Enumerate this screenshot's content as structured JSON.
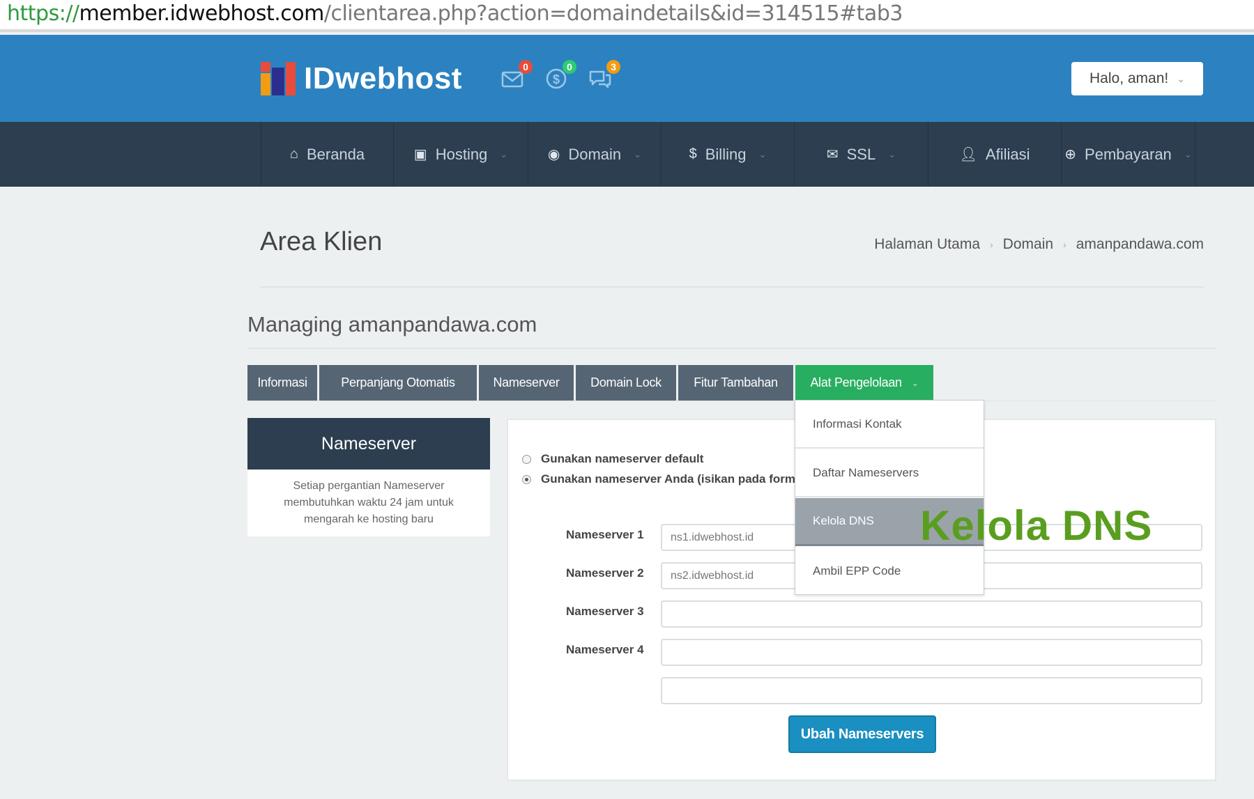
{
  "browser": {
    "url_protocol": "https://",
    "url_host": "member.idwebhost.com",
    "url_path": "/clientarea.php?action=domaindetails&id=314515#tab3"
  },
  "header": {
    "brand": "IDwebhost",
    "icons": [
      {
        "name": "envelope-icon",
        "count": "0",
        "badge_color": "#e74c3c"
      },
      {
        "name": "dollar-icon",
        "count": "0",
        "badge_color": "#2ecc71"
      },
      {
        "name": "chat-icon",
        "count": "3",
        "badge_color": "#f39c12"
      }
    ],
    "user_greeting": "Halo, aman!",
    "colors": {
      "header_bg": "#2c82c0",
      "nav_bg": "#2c3e50"
    }
  },
  "nav": {
    "items": [
      {
        "label": "Beranda",
        "icon": "home-icon"
      },
      {
        "label": "Hosting",
        "icon": "server-icon"
      },
      {
        "label": "Domain",
        "icon": "binoculars-icon"
      },
      {
        "label": "Billing",
        "icon": "dollar-icon"
      },
      {
        "label": "SSL",
        "icon": "envelope-icon"
      },
      {
        "label": "Afiliasi",
        "icon": "user-icon"
      },
      {
        "label": "Pembayaran",
        "icon": "globe-icon"
      }
    ]
  },
  "page": {
    "title": "Area Klien",
    "breadcrumb": [
      "Halaman Utama",
      "Domain",
      "amanpandawa.com"
    ],
    "managing": "Managing amanpandawa.com"
  },
  "tabs": [
    {
      "label": "Informasi"
    },
    {
      "label": "Perpanjang Otomatis"
    },
    {
      "label": "Nameserver"
    },
    {
      "label": "Domain Lock"
    },
    {
      "label": "Fitur Tambahan"
    },
    {
      "label": "Alat Pengelolaan",
      "active": true,
      "color": "#27ae60"
    }
  ],
  "sidebar": {
    "heading": "Nameserver",
    "note": "Setiap pergantian Nameserver membutuhkan waktu 24 jam untuk mengarah ke hosting baru"
  },
  "form": {
    "radio_default": "Gunakan nameserver default",
    "radio_custom": "Gunakan nameserver Anda (isikan pada form",
    "nameservers": [
      {
        "label": "Nameserver 1",
        "value": "ns1.idwebhost.id"
      },
      {
        "label": "Nameserver 2",
        "value": "ns2.idwebhost.id"
      },
      {
        "label": "Nameserver 3",
        "value": ""
      },
      {
        "label": "Nameserver 4",
        "value": ""
      }
    ],
    "extra_value": "",
    "submit_label": "Ubah Nameservers"
  },
  "dropdown": {
    "items": [
      {
        "label": "Informasi Kontak"
      },
      {
        "label": "Daftar Nameservers"
      },
      {
        "label": "Kelola DNS",
        "highlighted": true
      },
      {
        "label": "Ambil EPP Code"
      }
    ]
  },
  "annotation": "Kelola DNS"
}
